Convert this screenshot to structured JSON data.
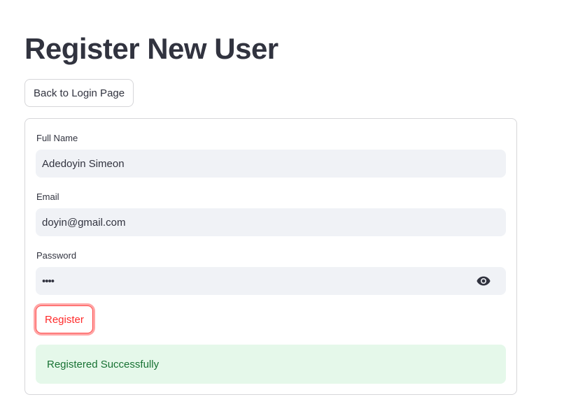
{
  "page": {
    "title": "Register New User"
  },
  "back_button": {
    "label": "Back to Login Page"
  },
  "form": {
    "full_name": {
      "label": "Full Name",
      "value": "Adedoyin Simeon"
    },
    "email": {
      "label": "Email",
      "value": "doyin@gmail.com"
    },
    "password": {
      "label": "Password",
      "masked_value": "••••",
      "toggle_icon": "eye-icon"
    },
    "submit_label": "Register"
  },
  "status": {
    "message": "Registered Successfully"
  },
  "colors": {
    "text": "#31333f",
    "input_background": "#f0f2f6",
    "primary_accent": "#ff4b4b",
    "success_background": "#e5f8ea",
    "success_text": "#177233"
  }
}
